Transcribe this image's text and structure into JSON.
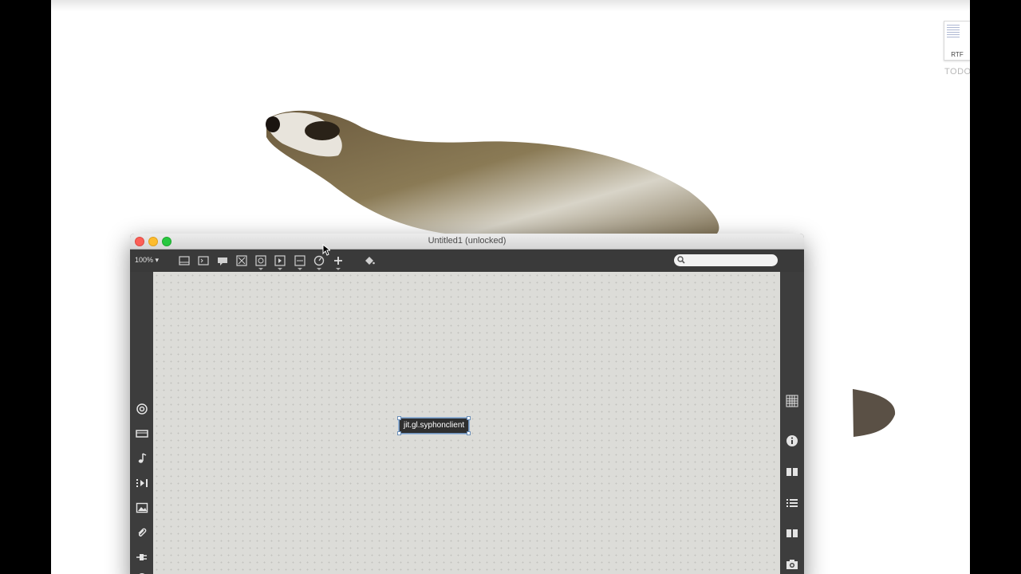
{
  "desktop": {
    "file_icon": {
      "extension": "RTF",
      "label": "TODO"
    }
  },
  "window": {
    "title": "Untitled1 (unlocked)",
    "toolbar": {
      "zoom": "100%",
      "zoom_arrow": "▾",
      "icons": [
        "presentation-icon",
        "number-box-icon",
        "comment-icon",
        "toggle-icon",
        "button-icon",
        "message-icon",
        "slider-icon",
        "dial-icon",
        "add-icon",
        "paint-bucket-icon"
      ]
    },
    "search": {
      "placeholder": ""
    }
  },
  "patch": {
    "objects": [
      {
        "text": "jit.gl.syphonclient"
      }
    ]
  },
  "sidebar_left": [
    "target-icon",
    "video-icon",
    "music-note-icon",
    "play-steps-icon",
    "image-icon",
    "paperclip-icon",
    "plug-icon"
  ],
  "sidebar_right": [
    "grid-icon",
    "info-icon",
    "book-icon",
    "list-icon",
    "open-book-icon",
    "camera-icon"
  ]
}
